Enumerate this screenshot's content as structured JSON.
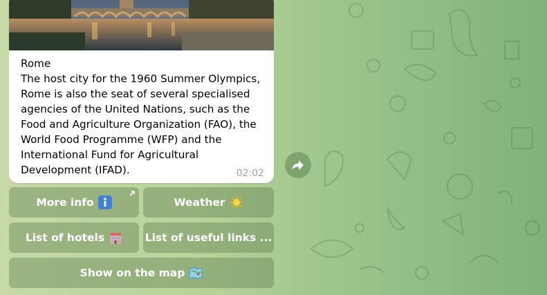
{
  "message": {
    "title": "Rome",
    "body": "The host city for the 1960 Summer Olympics, Rome is also the seat of several specialised agencies of the United Nations, such as the Food and Agriculture Organization (FAO), the World Food Programme (WFP) and the International Fund for Agricultural Development (IFAD).",
    "time": "02:02"
  },
  "keyboard": {
    "more_info": "More info",
    "weather": "Weather",
    "hotels": "List of hotels",
    "links": "List of useful links ...",
    "map": "Show on the map"
  },
  "icons": {
    "share": "share-icon",
    "external": "external-link-icon",
    "info": "info-icon",
    "sun": "sun-icon",
    "hotel": "hotel-icon",
    "map": "map-icon"
  },
  "colors": {
    "bubble": "#ffffff",
    "time": "#a0a0a0",
    "button_bg": "rgba(98,128,80,0.42)",
    "info_blue": "#3f7fd6"
  }
}
